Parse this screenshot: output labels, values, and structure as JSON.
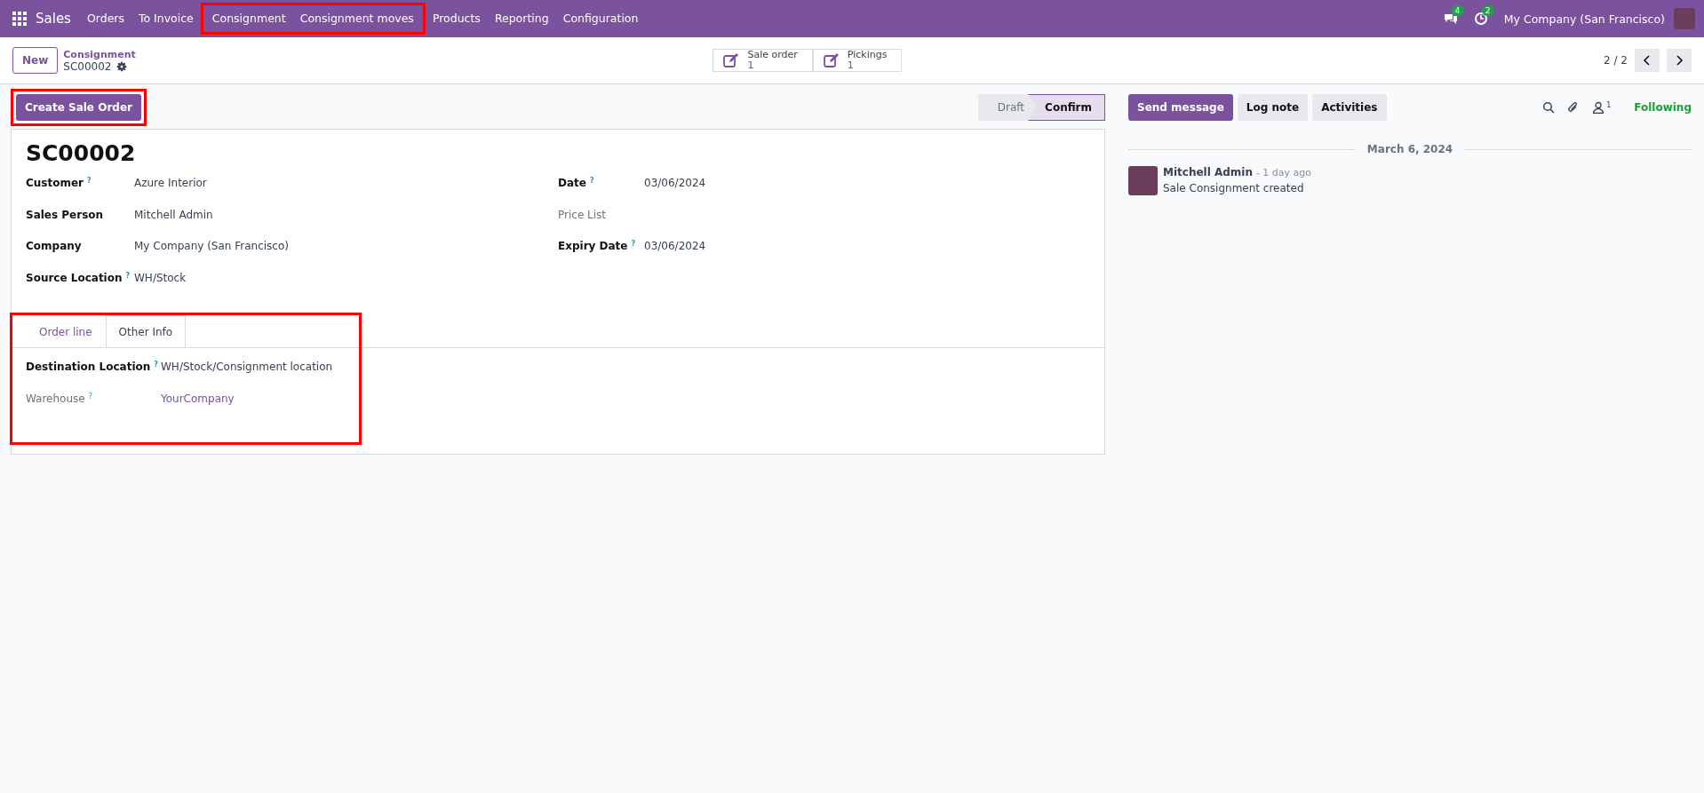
{
  "navbar": {
    "app": "Sales",
    "menu": [
      {
        "label": "Orders",
        "highlighted": false
      },
      {
        "label": "To Invoice",
        "highlighted": false
      },
      {
        "label": "Consignment",
        "highlighted": true
      },
      {
        "label": "Consignment moves",
        "highlighted": true
      },
      {
        "label": "Products",
        "highlighted": false
      },
      {
        "label": "Reporting",
        "highlighted": false
      },
      {
        "label": "Configuration",
        "highlighted": false
      }
    ],
    "messages_count": "4",
    "activities_count": "2",
    "company": "My Company (San Francisco)"
  },
  "control_panel": {
    "new_button": "New",
    "breadcrumb": "Consignment",
    "record": "SC00002",
    "stat_buttons": [
      {
        "label": "Sale order",
        "value": "1"
      },
      {
        "label": "Pickings",
        "value": "1"
      }
    ],
    "pager": "2 / 2"
  },
  "actions": {
    "create_button": {
      "label": "Create Sale Order",
      "highlighted": true
    },
    "statuses": [
      {
        "label": "Draft",
        "selected": false
      },
      {
        "label": "Confirm",
        "selected": true
      }
    ]
  },
  "form": {
    "title": "SC00002",
    "left_fields": [
      {
        "label": "Customer",
        "help": "?",
        "value": "Azure Interior",
        "muted": false,
        "kind": "text"
      },
      {
        "label": "Sales Person",
        "value": "Mitchell Admin",
        "muted": false,
        "kind": "text"
      },
      {
        "label": "Company",
        "value": "My Company (San Francisco)",
        "muted": false,
        "kind": "text"
      },
      {
        "label": "Source Location",
        "help": "?",
        "value": "WH/Stock",
        "muted": false,
        "kind": "text"
      }
    ],
    "right_fields": [
      {
        "label": "Date",
        "help": "?",
        "value": "03/06/2024",
        "muted": false,
        "kind": "text"
      },
      {
        "label": "Price List",
        "muted": true
      },
      {
        "label": "Expiry Date",
        "help": "?",
        "value": "03/06/2024",
        "muted": false,
        "kind": "text"
      }
    ],
    "notebook": {
      "highlighted": true,
      "tabs": [
        {
          "label": "Order line",
          "selected": false
        },
        {
          "label": "Other Info",
          "selected": true
        }
      ],
      "fields": [
        {
          "label": "Destination Location",
          "help": "?",
          "value": "WH/Stock/Consignment location",
          "muted": false,
          "kind": "text"
        },
        {
          "label": "Warehouse",
          "help": "?",
          "value": "YourCompany",
          "muted": true,
          "kind": "link"
        }
      ]
    }
  },
  "chatter": {
    "buttons": [
      {
        "label": "Send message",
        "selected": true
      },
      {
        "label": "Log note",
        "selected": false
      },
      {
        "label": "Activities",
        "selected": false
      }
    ],
    "followers_count": "1",
    "following": "Following",
    "date": "March 6, 2024",
    "messages": [
      {
        "author": "Mitchell Admin",
        "time": "- 1 day ago",
        "body": "Sale Consignment created"
      }
    ]
  }
}
